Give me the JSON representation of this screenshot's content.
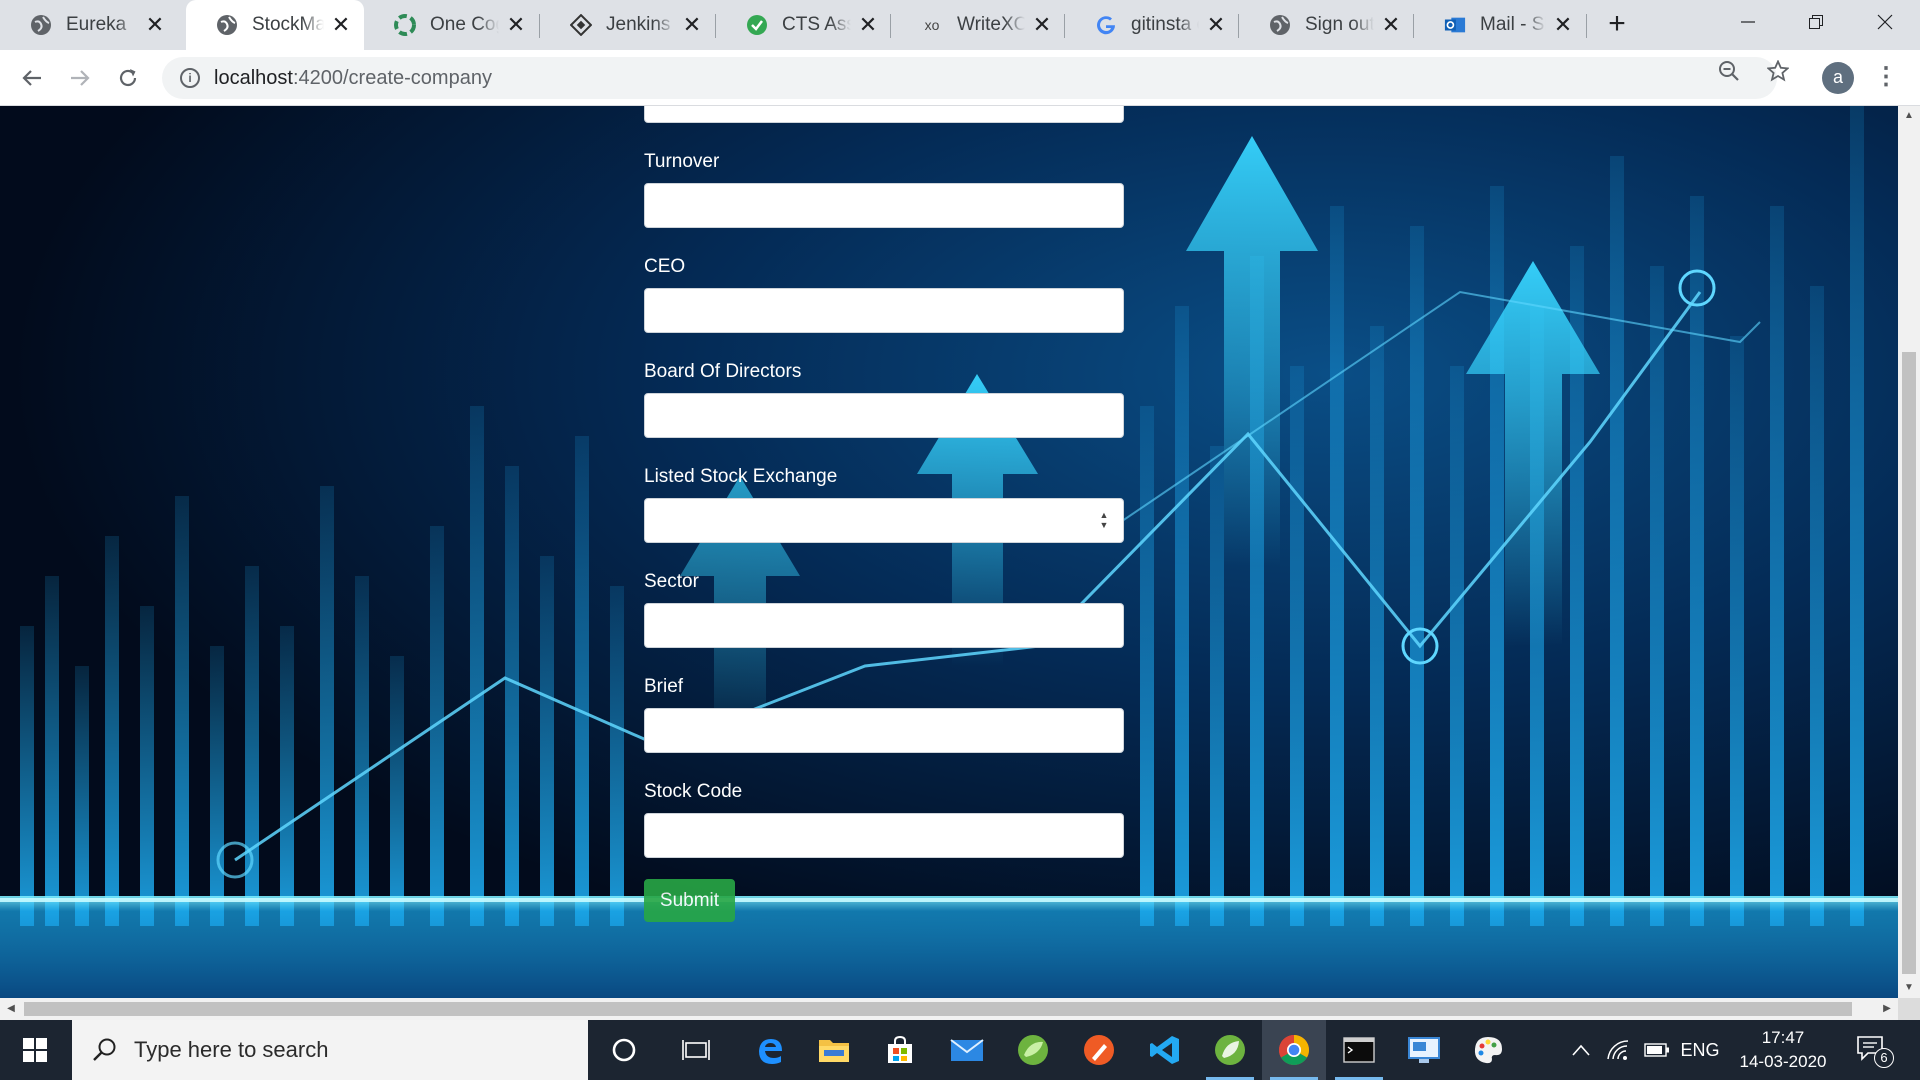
{
  "browser": {
    "tabs": [
      {
        "title": "Eureka",
        "icon": "globe-icon",
        "active": false
      },
      {
        "title": "StockMarket",
        "icon": "globe-icon",
        "active": true
      },
      {
        "title": "One Cognizant",
        "icon": "cognizant-icon",
        "active": false
      },
      {
        "title": "Jenkins â€“",
        "icon": "jenkins-icon",
        "active": false
      },
      {
        "title": "CTS Assessment",
        "icon": "check-circle-icon",
        "active": false
      },
      {
        "title": "WriteXO -",
        "icon": "xo-icon",
        "active": false
      },
      {
        "title": "gitinsta co",
        "icon": "google-icon",
        "active": false
      },
      {
        "title": "Sign out",
        "icon": "globe-icon",
        "active": false
      },
      {
        "title": "Mail - Shi",
        "icon": "outlook-icon",
        "active": false
      }
    ],
    "url_host": "localhost",
    "url_rest": ":4200/create-company"
  },
  "form": {
    "fields": [
      {
        "label": "",
        "type": "text",
        "value": ""
      },
      {
        "label": "Turnover",
        "type": "text",
        "value": ""
      },
      {
        "label": "CEO",
        "type": "text",
        "value": ""
      },
      {
        "label": "Board Of Directors",
        "type": "text",
        "value": ""
      },
      {
        "label": "Listed Stock Exchange",
        "type": "number",
        "value": ""
      },
      {
        "label": "Sector",
        "type": "text",
        "value": ""
      },
      {
        "label": "Brief",
        "type": "text",
        "value": ""
      },
      {
        "label": "Stock Code",
        "type": "text",
        "value": ""
      }
    ],
    "submit_label": "Submit",
    "submit_color": "#28a745"
  },
  "taskbar": {
    "search_placeholder": "Type here to search",
    "language": "ENG",
    "time": "17:47",
    "date": "14-03-2020",
    "notification_count": "6",
    "apps": [
      "cortana-icon",
      "task-view-icon",
      "edge-icon",
      "file-explorer-icon",
      "store-icon",
      "mail-icon",
      "spring-tool-suite-icon",
      "postman-icon",
      "vscode-icon",
      "spring-icon",
      "chrome-icon",
      "terminal-icon",
      "remote-desktop-icon",
      "paint-icon"
    ]
  }
}
